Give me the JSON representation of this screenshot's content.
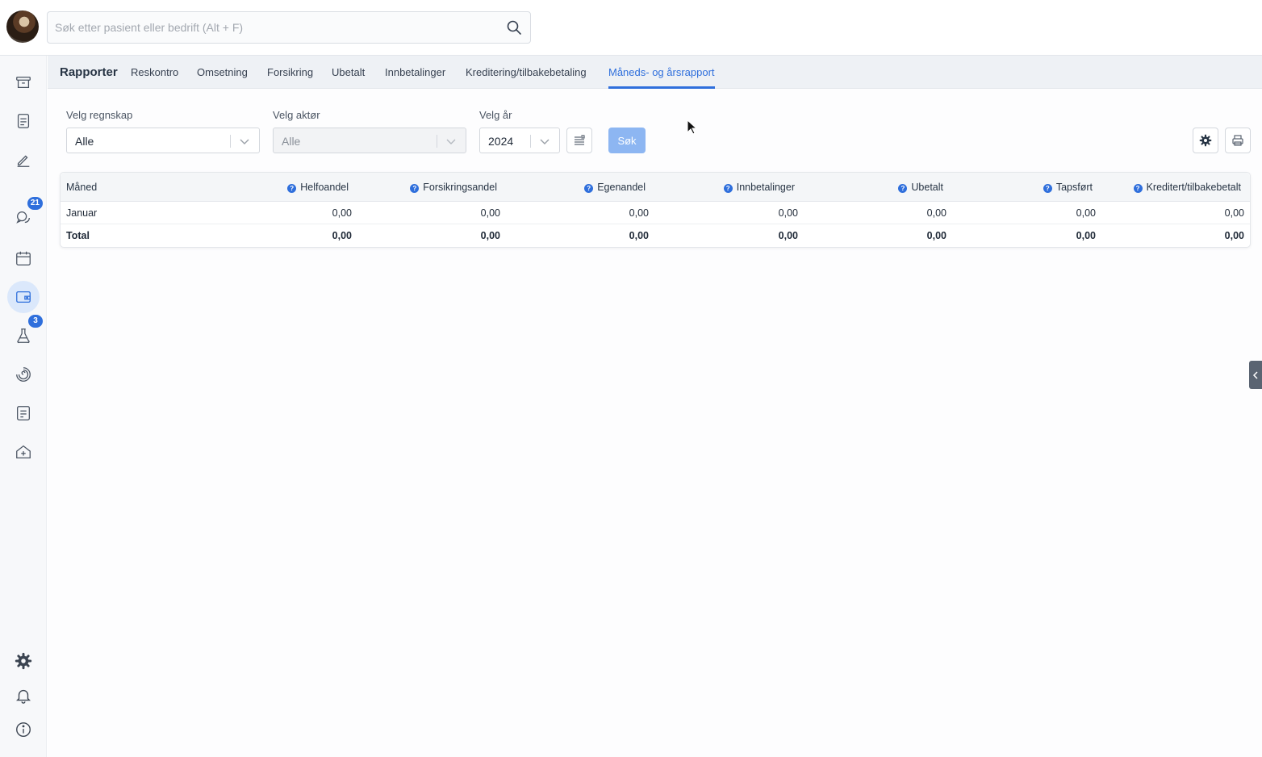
{
  "search": {
    "placeholder": "Søk etter pasient eller bedrift (Alt + F)"
  },
  "sidebar": {
    "items": [
      {
        "name": "archive",
        "icon": "archive-icon"
      },
      {
        "name": "document",
        "icon": "document-icon"
      },
      {
        "name": "pen",
        "icon": "pen-icon"
      },
      {
        "name": "messages",
        "icon": "chat-icon",
        "badge": "21"
      },
      {
        "name": "calendar",
        "icon": "calendar-icon"
      },
      {
        "name": "economy",
        "icon": "wallet-icon",
        "active": true
      },
      {
        "name": "lab",
        "icon": "flask-icon",
        "badge": "3"
      },
      {
        "name": "spiral",
        "icon": "spiral-icon"
      },
      {
        "name": "checklist",
        "icon": "checklist-icon"
      },
      {
        "name": "clinic",
        "icon": "house-plus-icon"
      }
    ],
    "bottom": [
      {
        "name": "settings",
        "icon": "gear-icon"
      },
      {
        "name": "notifications",
        "icon": "bell-icon"
      },
      {
        "name": "info",
        "icon": "info-icon"
      }
    ]
  },
  "tabs": {
    "title": "Rapporter",
    "items": [
      {
        "label": "Reskontro"
      },
      {
        "label": "Omsetning"
      },
      {
        "label": "Forsikring"
      },
      {
        "label": "Ubetalt"
      },
      {
        "label": "Innbetalinger"
      },
      {
        "label": "Kreditering/tilbakebetaling"
      },
      {
        "label": "Måneds- og årsrapport",
        "active": true
      }
    ]
  },
  "filters": {
    "regnskap": {
      "label": "Velg regnskap",
      "value": "Alle"
    },
    "aktor": {
      "label": "Velg aktør",
      "value": "Alle",
      "disabled": true
    },
    "year": {
      "label": "Velg år",
      "value": "2024"
    },
    "search_button": "Søk"
  },
  "table": {
    "columns": [
      "Måned",
      "Helfoandel",
      "Forsikringsandel",
      "Egenandel",
      "Innbetalinger",
      "Ubetalt",
      "Tapsført",
      "Kreditert/tilbakebetalt"
    ],
    "rows": [
      {
        "cells": [
          "Januar",
          "0,00",
          "0,00",
          "0,00",
          "0,00",
          "0,00",
          "0,00",
          "0,00"
        ]
      }
    ],
    "total": {
      "cells": [
        "Total",
        "0,00",
        "0,00",
        "0,00",
        "0,00",
        "0,00",
        "0,00",
        "0,00"
      ]
    }
  },
  "colors": {
    "accent": "#2f6fdc",
    "search_button": "#8db6f2",
    "badge": "#2f6fdc"
  }
}
